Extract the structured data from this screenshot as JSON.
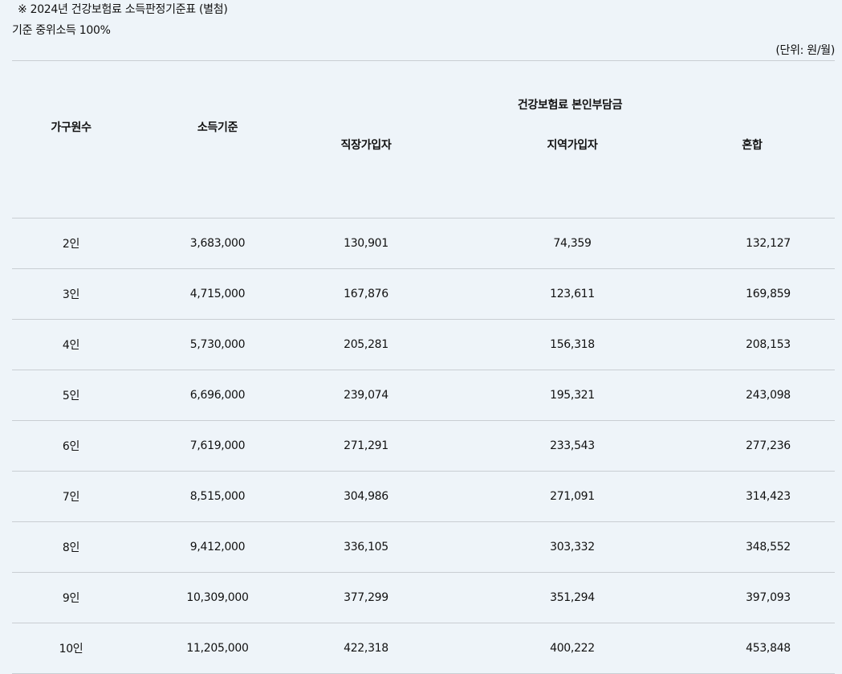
{
  "header": {
    "note": "※ 2024년 건강보험료 소득판정기준표 (별첨)",
    "subtitle": "기준 중위소득 100%",
    "unit": "(단위: 원/월)"
  },
  "table": {
    "columns": {
      "household": "가구원수",
      "income": "소득기준",
      "group": "건강보험료 본인부담금",
      "employee": "직장가입자",
      "regional": "지역가입자",
      "mixed": "혼합"
    },
    "rows": [
      {
        "household": "2인",
        "income": "3,683,000",
        "employee": "130,901",
        "regional": "74,359",
        "mixed": "132,127"
      },
      {
        "household": "3인",
        "income": "4,715,000",
        "employee": "167,876",
        "regional": "123,611",
        "mixed": "169,859"
      },
      {
        "household": "4인",
        "income": "5,730,000",
        "employee": "205,281",
        "regional": "156,318",
        "mixed": "208,153"
      },
      {
        "household": "5인",
        "income": "6,696,000",
        "employee": "239,074",
        "regional": "195,321",
        "mixed": "243,098"
      },
      {
        "household": "6인",
        "income": "7,619,000",
        "employee": "271,291",
        "regional": "233,543",
        "mixed": "277,236"
      },
      {
        "household": "7인",
        "income": "8,515,000",
        "employee": "304,986",
        "regional": "271,091",
        "mixed": "314,423"
      },
      {
        "household": "8인",
        "income": "9,412,000",
        "employee": "336,105",
        "regional": "303,332",
        "mixed": "348,552"
      },
      {
        "household": "9인",
        "income": "10,309,000",
        "employee": "377,299",
        "regional": "351,294",
        "mixed": "397,093"
      },
      {
        "household": "10인",
        "income": "11,205,000",
        "employee": "422,318",
        "regional": "400,222",
        "mixed": "453,848"
      }
    ]
  }
}
